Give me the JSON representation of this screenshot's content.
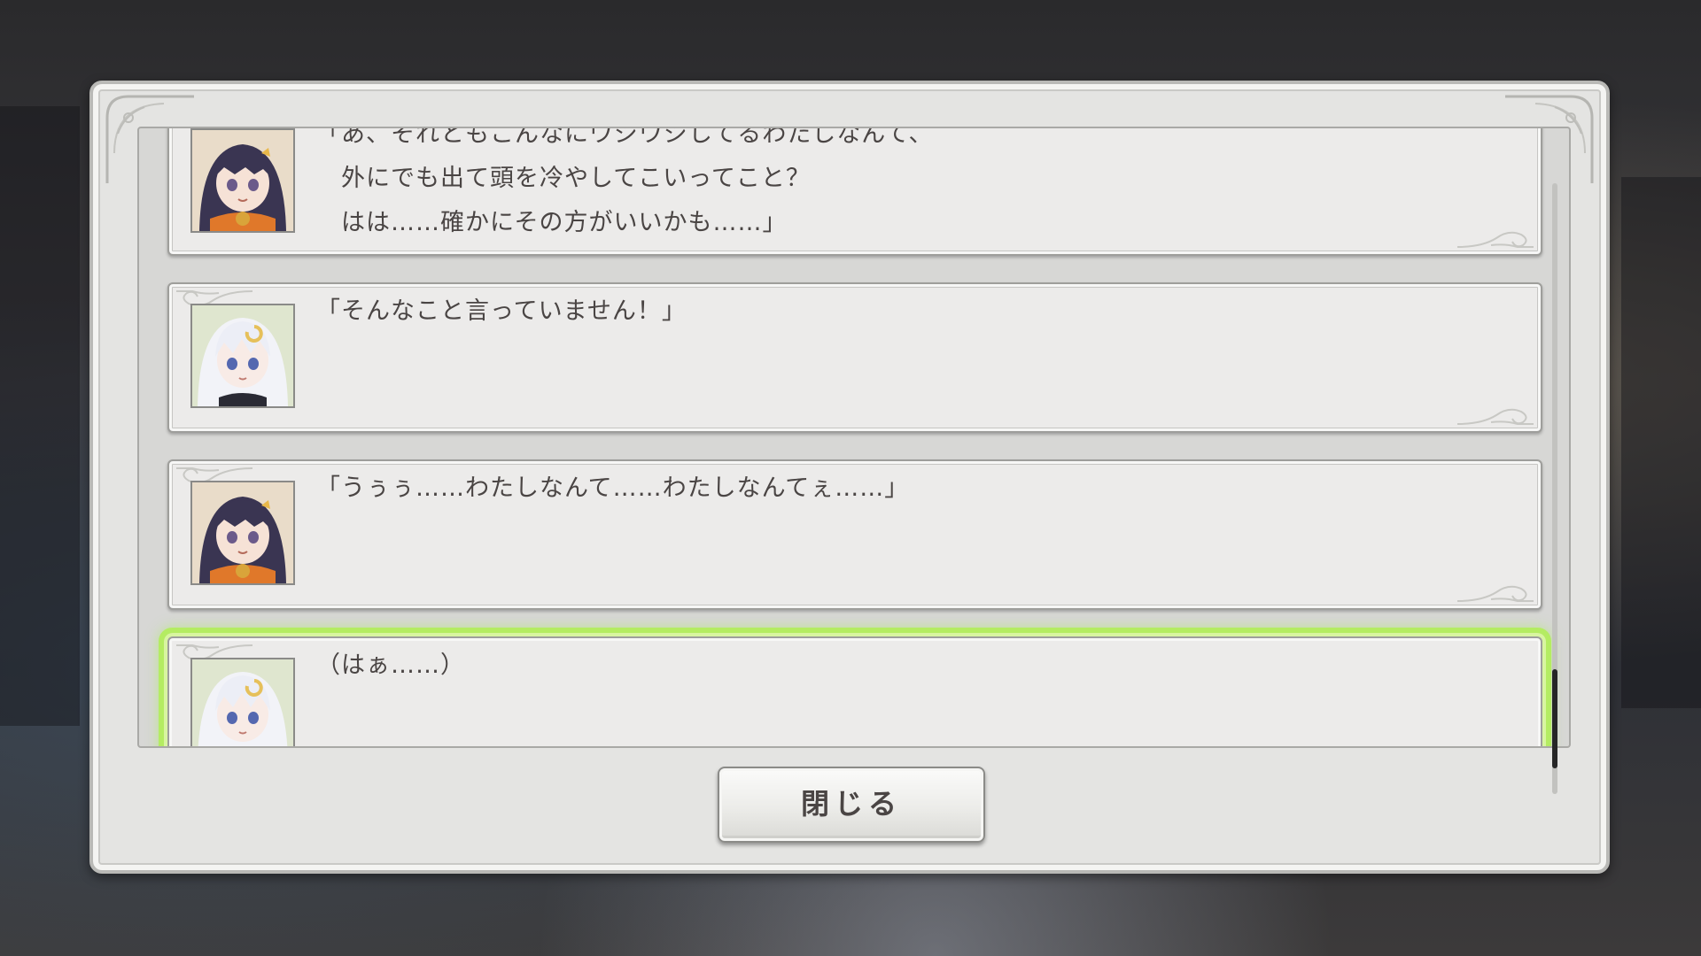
{
  "dialog": {
    "close_label": "閉じる",
    "entries": [
      {
        "speaker_icon": "dark-haired-girl-portrait",
        "text": "「あ、それともこんなにウジウジしてるわたしなんて、\n　外にでも出て頭を冷やしてこいってこと？\n　はは……確かにその方がいいかも……」"
      },
      {
        "speaker_icon": "white-haired-girl-portrait",
        "text": "「そんなこと言っていません！」"
      },
      {
        "speaker_icon": "dark-haired-girl-portrait",
        "text": "「うぅぅ……わたしなんて……わたしなんてぇ……」"
      },
      {
        "speaker_icon": "white-haired-girl-portrait",
        "text": "（はぁ……）"
      }
    ],
    "highlight_color": "#b4ec62",
    "scroll_position": 0.95
  }
}
